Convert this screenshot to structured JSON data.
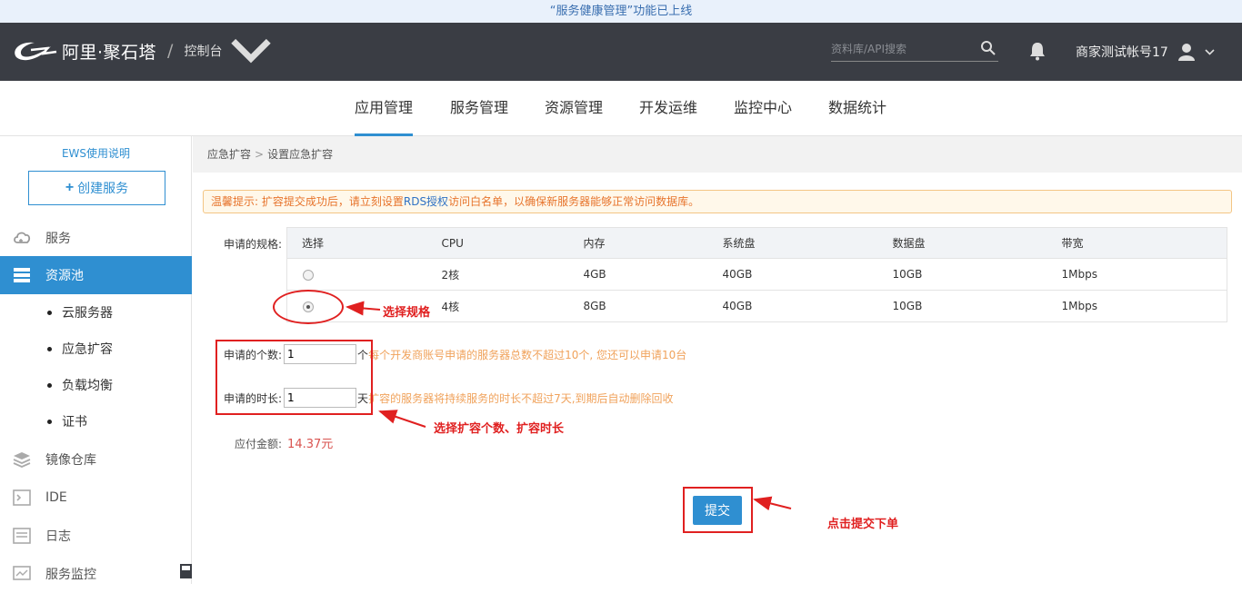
{
  "banner": {
    "text": "“服务健康管理”功能已上线"
  },
  "header": {
    "brand": "阿里·聚石塔",
    "separator": "/",
    "console": "控制台",
    "search_placeholder": "资料库/API搜索",
    "account": "商家测试帐号17"
  },
  "mainnav": {
    "tabs": [
      {
        "label": "应用管理",
        "active": true
      },
      {
        "label": "服务管理",
        "active": false
      },
      {
        "label": "资源管理",
        "active": false
      },
      {
        "label": "开发运维",
        "active": false
      },
      {
        "label": "监控中心",
        "active": false
      },
      {
        "label": "数据统计",
        "active": false
      }
    ]
  },
  "sidebar": {
    "ews": "EWS使用说明",
    "create_button": "创建服务",
    "items": [
      {
        "label": "服务",
        "icon": "cloud-icon"
      },
      {
        "label": "资源池",
        "icon": "server-icon",
        "active": true
      },
      {
        "label": "镜像仓库",
        "icon": "layers-icon"
      },
      {
        "label": "IDE",
        "icon": "terminal-icon"
      },
      {
        "label": "日志",
        "icon": "log-icon"
      },
      {
        "label": "服务监控",
        "icon": "monitor-icon"
      }
    ],
    "subitems": [
      "云服务器",
      "应急扩容",
      "负载均衡",
      "证书"
    ]
  },
  "breadcrumb": {
    "first": "应急扩容",
    "sep": ">",
    "second": "设置应急扩容"
  },
  "tip": {
    "before": "温馨提示: 扩容提交成功后，请立刻设置",
    "link": "RDS授权",
    "after": "访问白名单，以确保新服务器能够正常访问数据库。"
  },
  "spec": {
    "label": "申请的规格:",
    "headers": [
      "选择",
      "CPU",
      "内存",
      "系统盘",
      "数据盘",
      "带宽"
    ],
    "rows": [
      {
        "selected": false,
        "cpu": "2核",
        "mem": "4GB",
        "sys": "40GB",
        "data": "10GB",
        "bw": "1Mbps"
      },
      {
        "selected": true,
        "cpu": "4核",
        "mem": "8GB",
        "sys": "40GB",
        "data": "10GB",
        "bw": "1Mbps"
      }
    ]
  },
  "count": {
    "label": "申请的个数:",
    "value": "1",
    "unit": "个",
    "hint": "每个开发商账号申请的服务器总数不超过10个, 您还可以申请10台"
  },
  "duration": {
    "label": "申请的时长:",
    "value": "1",
    "unit": "天",
    "hint": "扩容的服务器将持续服务的时长不超过7天,到期后自动删除回收"
  },
  "payment": {
    "label": "应付金额:",
    "amount": "14.37元"
  },
  "submit_label": "提交",
  "annotations": {
    "spec": "选择规格",
    "count_duration": "选择扩容个数、扩容时长",
    "submit": "点击提交下单",
    "color": "#e02020"
  }
}
